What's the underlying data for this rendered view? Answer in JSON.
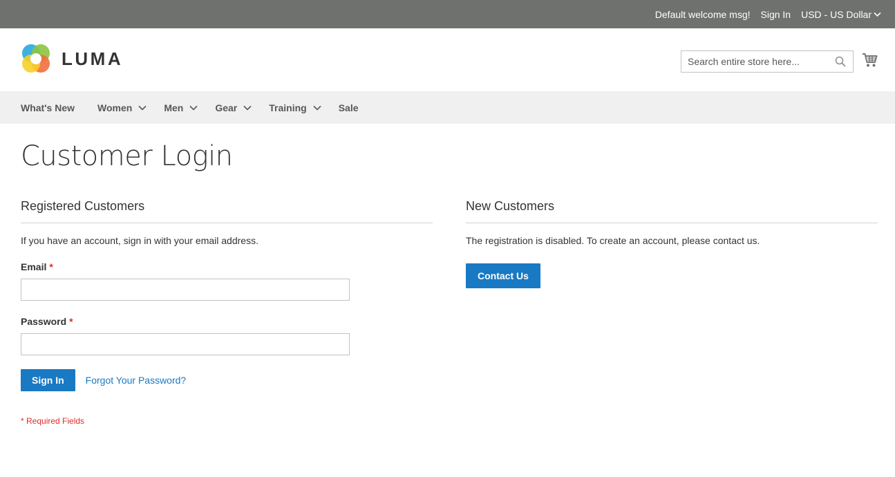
{
  "topbar": {
    "welcome": "Default welcome msg!",
    "sign_in": "Sign In",
    "currency": "USD - US Dollar"
  },
  "header": {
    "logo_text": "LUMA",
    "search_placeholder": "Search entire store here...",
    "search_value": ""
  },
  "nav": {
    "items": [
      {
        "label": "What's New",
        "has_dropdown": false
      },
      {
        "label": "Women",
        "has_dropdown": true
      },
      {
        "label": "Men",
        "has_dropdown": true
      },
      {
        "label": "Gear",
        "has_dropdown": true
      },
      {
        "label": "Training",
        "has_dropdown": true
      },
      {
        "label": "Sale",
        "has_dropdown": false
      }
    ]
  },
  "page": {
    "title": "Customer Login"
  },
  "registered": {
    "title": "Registered Customers",
    "intro": "If you have an account, sign in with your email address.",
    "email_label": "Email",
    "email_value": "",
    "password_label": "Password",
    "password_value": "",
    "required_marker": "*",
    "sign_in_button": "Sign In",
    "forgot_link": "Forgot Your Password?",
    "required_note": "* Required Fields"
  },
  "new_customers": {
    "title": "New Customers",
    "text": "The registration is disabled. To create an account, please contact us.",
    "contact_button": "Contact Us"
  },
  "colors": {
    "topbar_bg": "#6e716e",
    "nav_bg": "#f0f0f0",
    "primary": "#1979c3",
    "required": "#e02b27"
  },
  "icons": {
    "search": "search-icon",
    "cart": "cart-icon",
    "chevron": "chevron-down-icon",
    "logo": "luma-logo-icon"
  }
}
